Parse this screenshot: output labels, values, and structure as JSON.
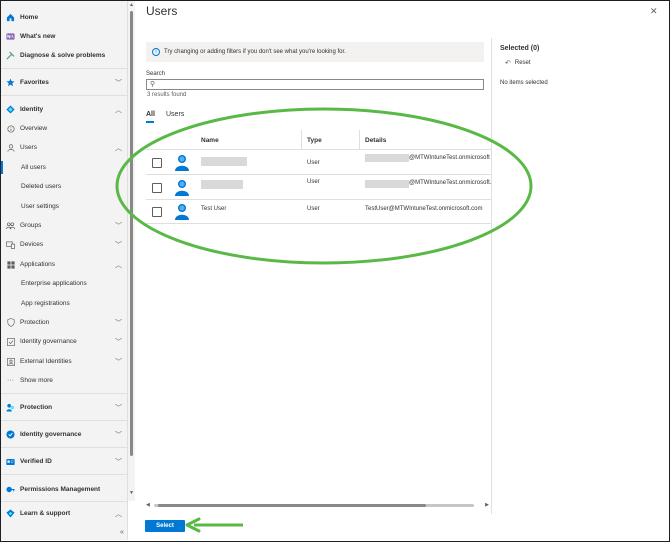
{
  "sidebar": {
    "items": [
      {
        "label": "Home",
        "icon": "home-icon"
      },
      {
        "label": "What's new",
        "icon": "whats-new-icon"
      },
      {
        "label": "Diagnose & solve problems",
        "icon": "diagnose-icon"
      },
      {
        "label": "Favorites",
        "icon": "star-icon"
      },
      {
        "label": "Identity",
        "icon": "identity-icon"
      },
      {
        "label": "Overview",
        "icon": "info-icon"
      },
      {
        "label": "Users",
        "icon": "user-icon"
      },
      {
        "label": "All users"
      },
      {
        "label": "Deleted users"
      },
      {
        "label": "User settings"
      },
      {
        "label": "Groups",
        "icon": "groups-icon"
      },
      {
        "label": "Devices",
        "icon": "devices-icon"
      },
      {
        "label": "Applications",
        "icon": "applications-icon"
      },
      {
        "label": "Enterprise applications"
      },
      {
        "label": "App registrations"
      },
      {
        "label": "Protection",
        "icon": "protection-icon"
      },
      {
        "label": "Identity governance",
        "icon": "governance-icon"
      },
      {
        "label": "External Identities",
        "icon": "external-identities-icon"
      },
      {
        "label": "Show more",
        "icon": "more-icon"
      },
      {
        "label": "Protection",
        "icon": "protection-icon"
      },
      {
        "label": "Identity governance",
        "icon": "governance-icon"
      },
      {
        "label": "Verified ID",
        "icon": "verified-id-icon"
      },
      {
        "label": "Permissions Management",
        "icon": "permissions-icon"
      },
      {
        "label": "Learn & support",
        "icon": "learn-icon"
      }
    ]
  },
  "panel": {
    "title": "Users",
    "info_text": "Try changing or adding filters if you don't see what you're looking for.",
    "search_label": "Search",
    "search_value": "",
    "results_text": "3 results found",
    "tabs": [
      "All",
      "Users"
    ],
    "active_tab": "All",
    "columns": [
      "Name",
      "Type",
      "Details"
    ],
    "rows": [
      {
        "name": "",
        "type": "User",
        "details": "@MTWIntuneTest.onmicrosoft",
        "name_redacted": true,
        "details_redacted": true
      },
      {
        "name": "",
        "type": "User",
        "details": "@MTWIntuneTest.onmicrosoft.",
        "name_redacted": true,
        "details_redacted": true
      },
      {
        "name": "Test User",
        "type": "User",
        "details": "TestUser@MTWIntuneTest.onmicrosoft.com",
        "name_redacted": false,
        "details_redacted": false
      }
    ],
    "select_button": "Select"
  },
  "selected": {
    "title": "Selected (0)",
    "reset_label": "Reset",
    "empty_text": "No items selected"
  },
  "colors": {
    "accent": "#0078d4",
    "annotation": "#5ab946"
  }
}
